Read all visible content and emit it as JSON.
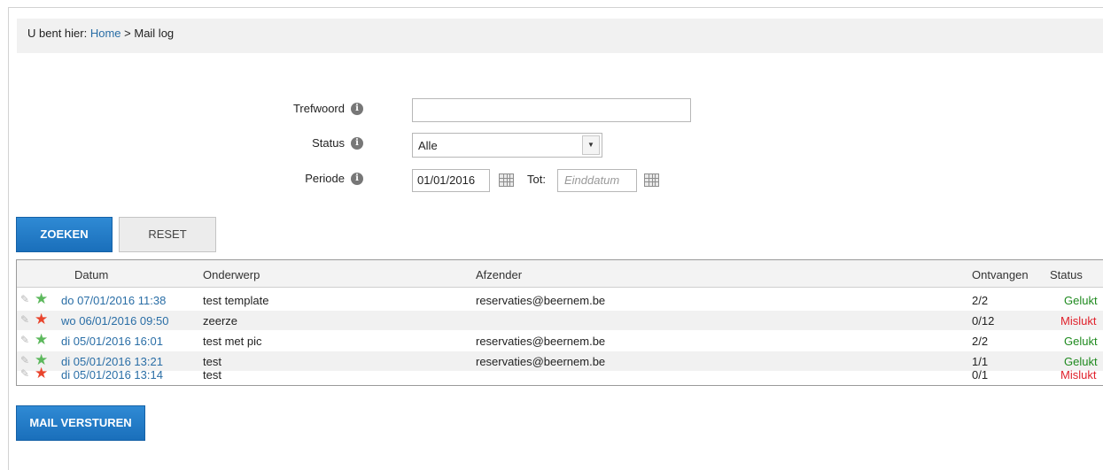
{
  "breadcrumb": {
    "prefix": "U bent hier:",
    "home": "Home",
    "separator": ">",
    "current": "Mail log"
  },
  "filters": {
    "keyword": {
      "label": "Trefwoord",
      "value": ""
    },
    "status": {
      "label": "Status",
      "value": "Alle"
    },
    "period": {
      "label": "Periode",
      "from": "01/01/2016",
      "to_label": "Tot:",
      "to_placeholder": "Einddatum"
    }
  },
  "buttons": {
    "search": "ZOEKEN",
    "reset": "RESET",
    "send_mail": "MAIL VERSTUREN"
  },
  "table": {
    "headers": {
      "date": "Datum",
      "subject": "Onderwerp",
      "sender": "Afzender",
      "received": "Ontvangen",
      "status": "Status"
    },
    "rows": [
      {
        "date": "do 07/01/2016 11:38",
        "subject": "test template",
        "sender": "reservaties@beernem.be",
        "received": "2/2",
        "status": "Gelukt",
        "star": "green"
      },
      {
        "date": "wo 06/01/2016 09:50",
        "subject": "zeerze",
        "sender": "",
        "received": "0/12",
        "status": "Mislukt",
        "star": "red"
      },
      {
        "date": "di 05/01/2016 16:01",
        "subject": "test met pic",
        "sender": "reservaties@beernem.be",
        "received": "2/2",
        "status": "Gelukt",
        "star": "green"
      },
      {
        "date": "di 05/01/2016 13:21",
        "subject": "test",
        "sender": "reservaties@beernem.be",
        "received": "1/1",
        "status": "Gelukt",
        "star": "green"
      },
      {
        "date": "di 05/01/2016 13:14",
        "subject": "test",
        "sender": "",
        "received": "0/1",
        "status": "Mislukt",
        "star": "red"
      }
    ]
  },
  "colors": {
    "link": "#2a6ea6",
    "success": "#1f8a1f",
    "failure": "#e0212b",
    "primary_button": "#1f78c6"
  }
}
